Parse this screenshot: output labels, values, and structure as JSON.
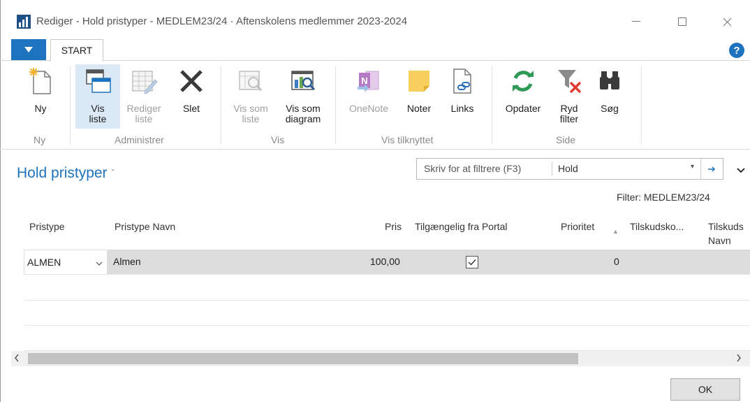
{
  "window": {
    "title": "Rediger - Hold pristyper - MEDLEM23/24 · Aftenskolens medlemmer 2023-2024"
  },
  "ribbon": {
    "tab_start": "START",
    "help": "?",
    "buttons": {
      "ny": "Ny",
      "vis_liste_1": "Vis",
      "vis_liste_2": "liste",
      "rediger_liste_1": "Rediger",
      "rediger_liste_2": "liste",
      "slet": "Slet",
      "vis_som_liste_1": "Vis som",
      "vis_som_liste_2": "liste",
      "vis_som_diagram_1": "Vis som",
      "vis_som_diagram_2": "diagram",
      "onenote": "OneNote",
      "noter": "Noter",
      "links": "Links",
      "opdater": "Opdater",
      "ryd_filter_1": "Ryd",
      "ryd_filter_2": "filter",
      "soeg": "Søg"
    },
    "groups": {
      "ny": "Ny",
      "administrer": "Administrer",
      "vis": "Vis",
      "vis_tilknyttet": "Vis tilknyttet",
      "side": "Side"
    }
  },
  "page": {
    "title": "Hold pristyper",
    "title_caret": "ˇ",
    "filter_placeholder": "Skriv for at filtrere (F3)",
    "filter_field": "Hold",
    "filter_text": "Filter: MEDLEM23/24"
  },
  "grid": {
    "columns": {
      "pristype": "Pristype",
      "pristype_navn": "Pristype Navn",
      "pris": "Pris",
      "tilgaengelig": "Tilgængelig fra Portal",
      "prioritet": "Prioritet",
      "tilskudsko": "Tilskudsko...",
      "tilskuds_navn_1": "Tilskuds",
      "tilskuds_navn_2": "Navn"
    },
    "rows": [
      {
        "pristype": "ALMEN",
        "pristype_navn": "Almen",
        "pris": "100,00",
        "tilgaengelig": true,
        "prioritet": "0"
      }
    ]
  },
  "footer": {
    "ok": "OK"
  },
  "colors": {
    "accent": "#1e73be",
    "selected_row": "#dcdcdc"
  }
}
